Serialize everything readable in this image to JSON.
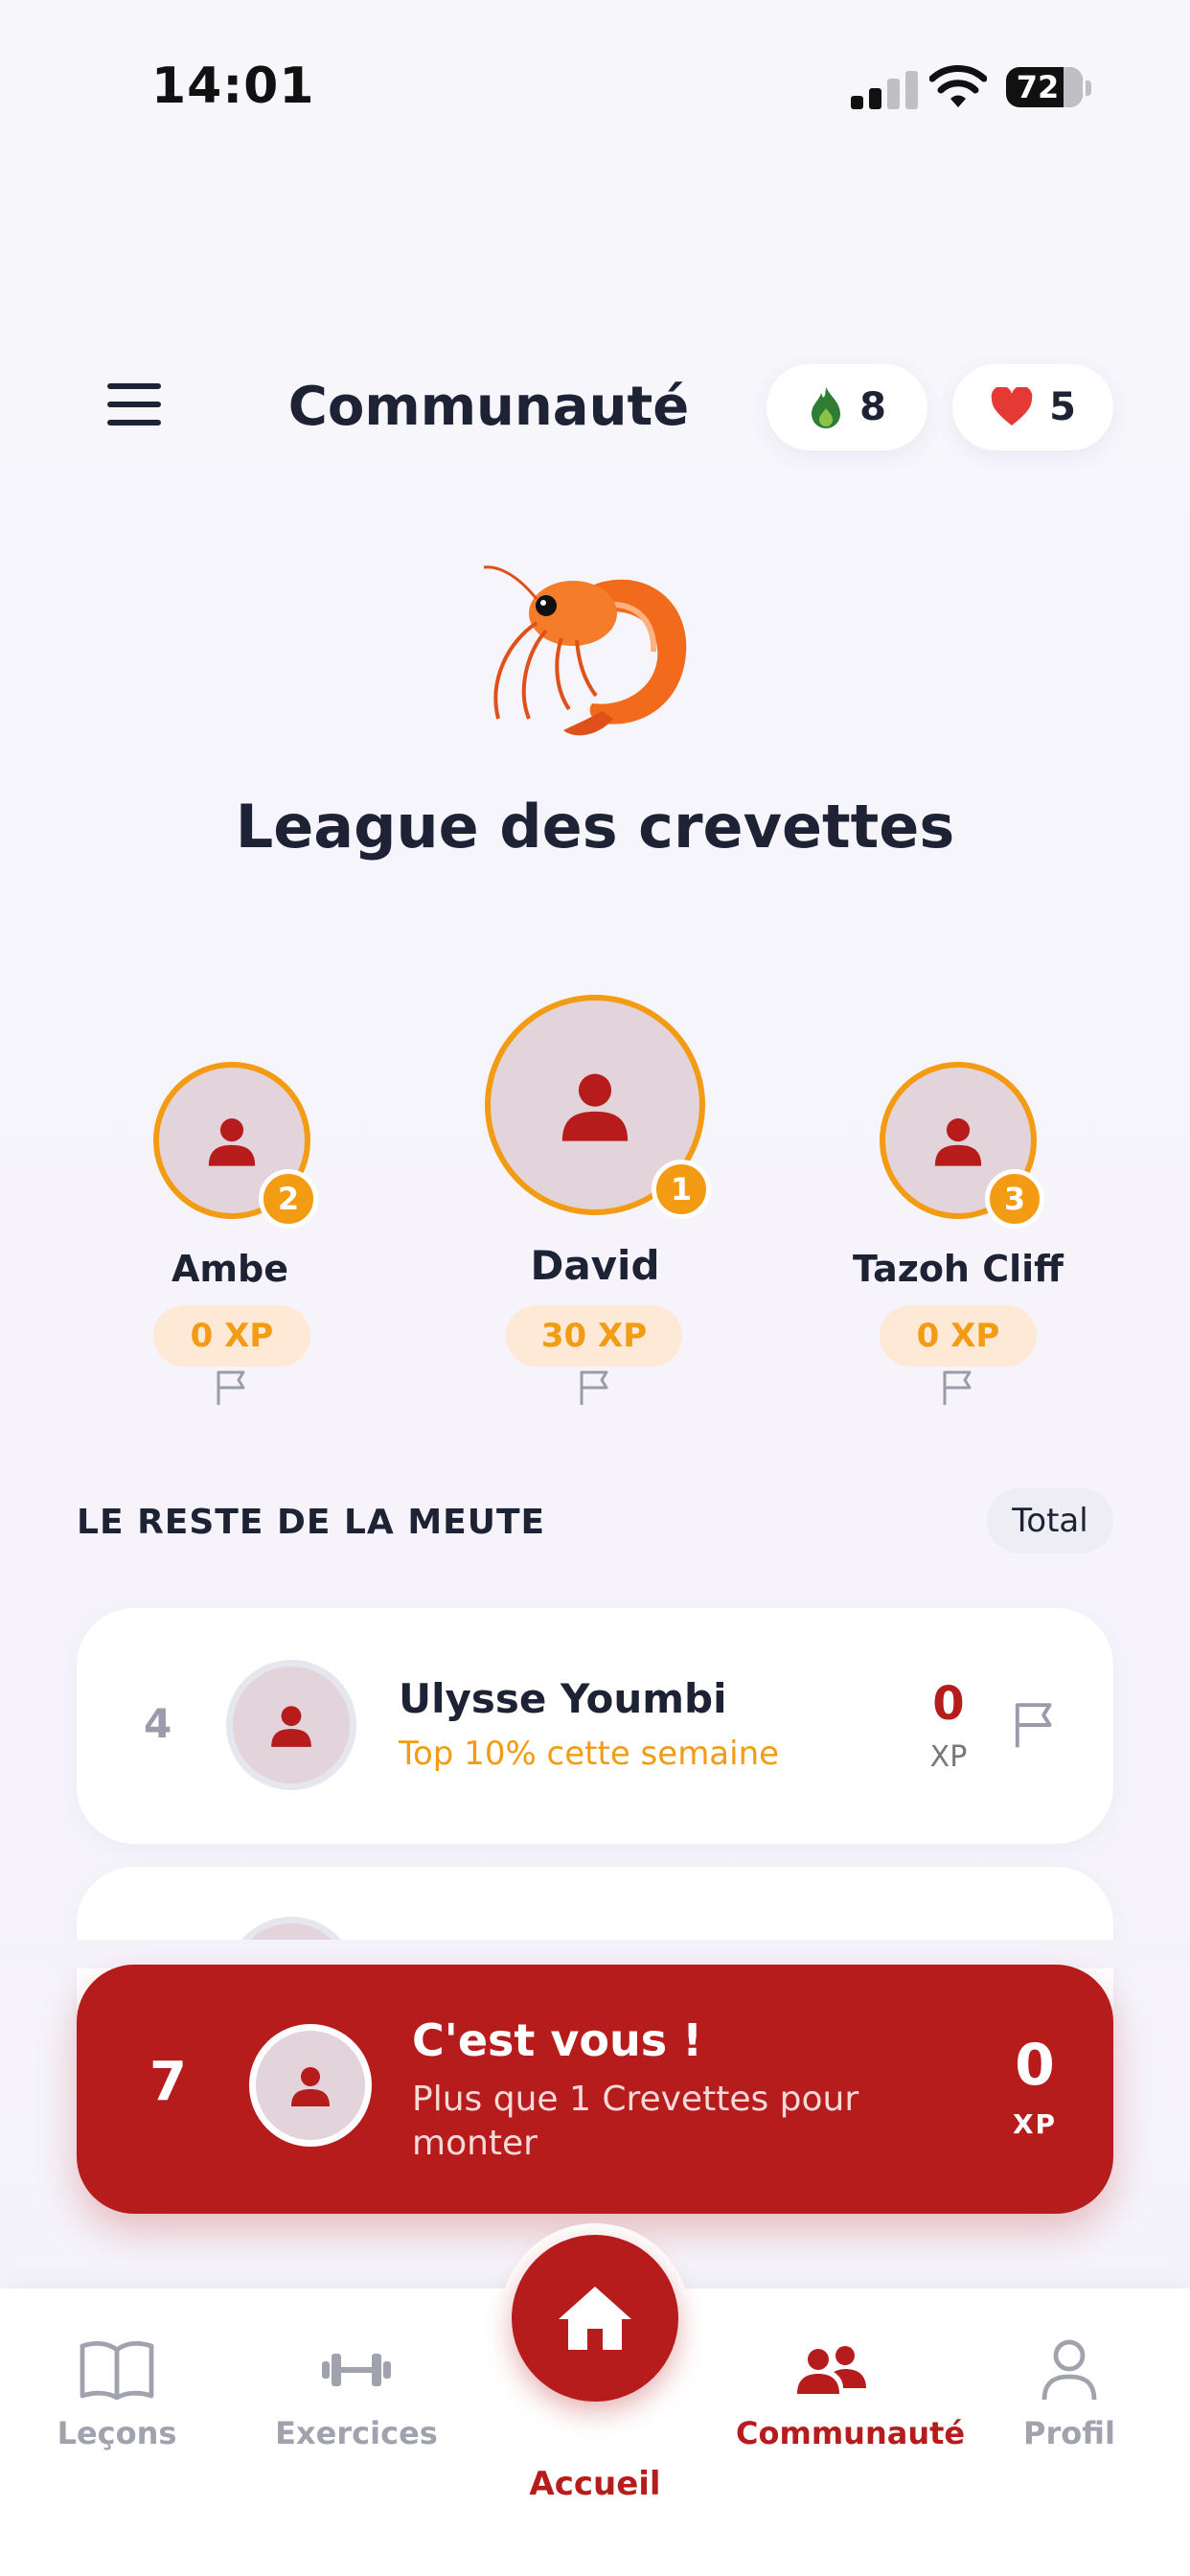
{
  "status_bar": {
    "time": "14:01",
    "battery": "72"
  },
  "header": {
    "title": "Communauté",
    "streak_count": "8",
    "lives_count": "5"
  },
  "league": {
    "title": "League des crevettes"
  },
  "podium": [
    {
      "name": "David",
      "xp": "30 XP",
      "rank": "1"
    },
    {
      "name": "Ambe",
      "xp": "0 XP",
      "rank": "2"
    },
    {
      "name": "Tazoh Cliff",
      "xp": "0 XP",
      "rank": "3"
    }
  ],
  "rest_section": {
    "label": "LE RESTE DE LA MEUTE",
    "filter": "Total"
  },
  "rows": [
    {
      "rank": "4",
      "name": "Ulysse Youmbi",
      "subtitle": "Top 10% cette semaine",
      "xp": "0",
      "xp_label": "XP"
    }
  ],
  "you_card": {
    "rank": "7",
    "title": "C'est vous !",
    "subtitle": "Plus que 1 Crevettes pour monter",
    "xp": "0",
    "xp_label": "XP"
  },
  "tabs": [
    {
      "label": "Leçons",
      "icon": "book-icon",
      "active": false
    },
    {
      "label": "Exercices",
      "icon": "dumbbell-icon",
      "active": false
    },
    {
      "label": "Accueil",
      "icon": "home-icon",
      "active": false
    },
    {
      "label": "Communauté",
      "icon": "community-icon",
      "active": true
    },
    {
      "label": "Profil",
      "icon": "profile-icon",
      "active": false
    }
  ],
  "colors": {
    "brand_red": "#b71c1c",
    "gold": "#f29b13",
    "navy": "#1d2235",
    "inactive_tab": "#a0a2ae"
  }
}
